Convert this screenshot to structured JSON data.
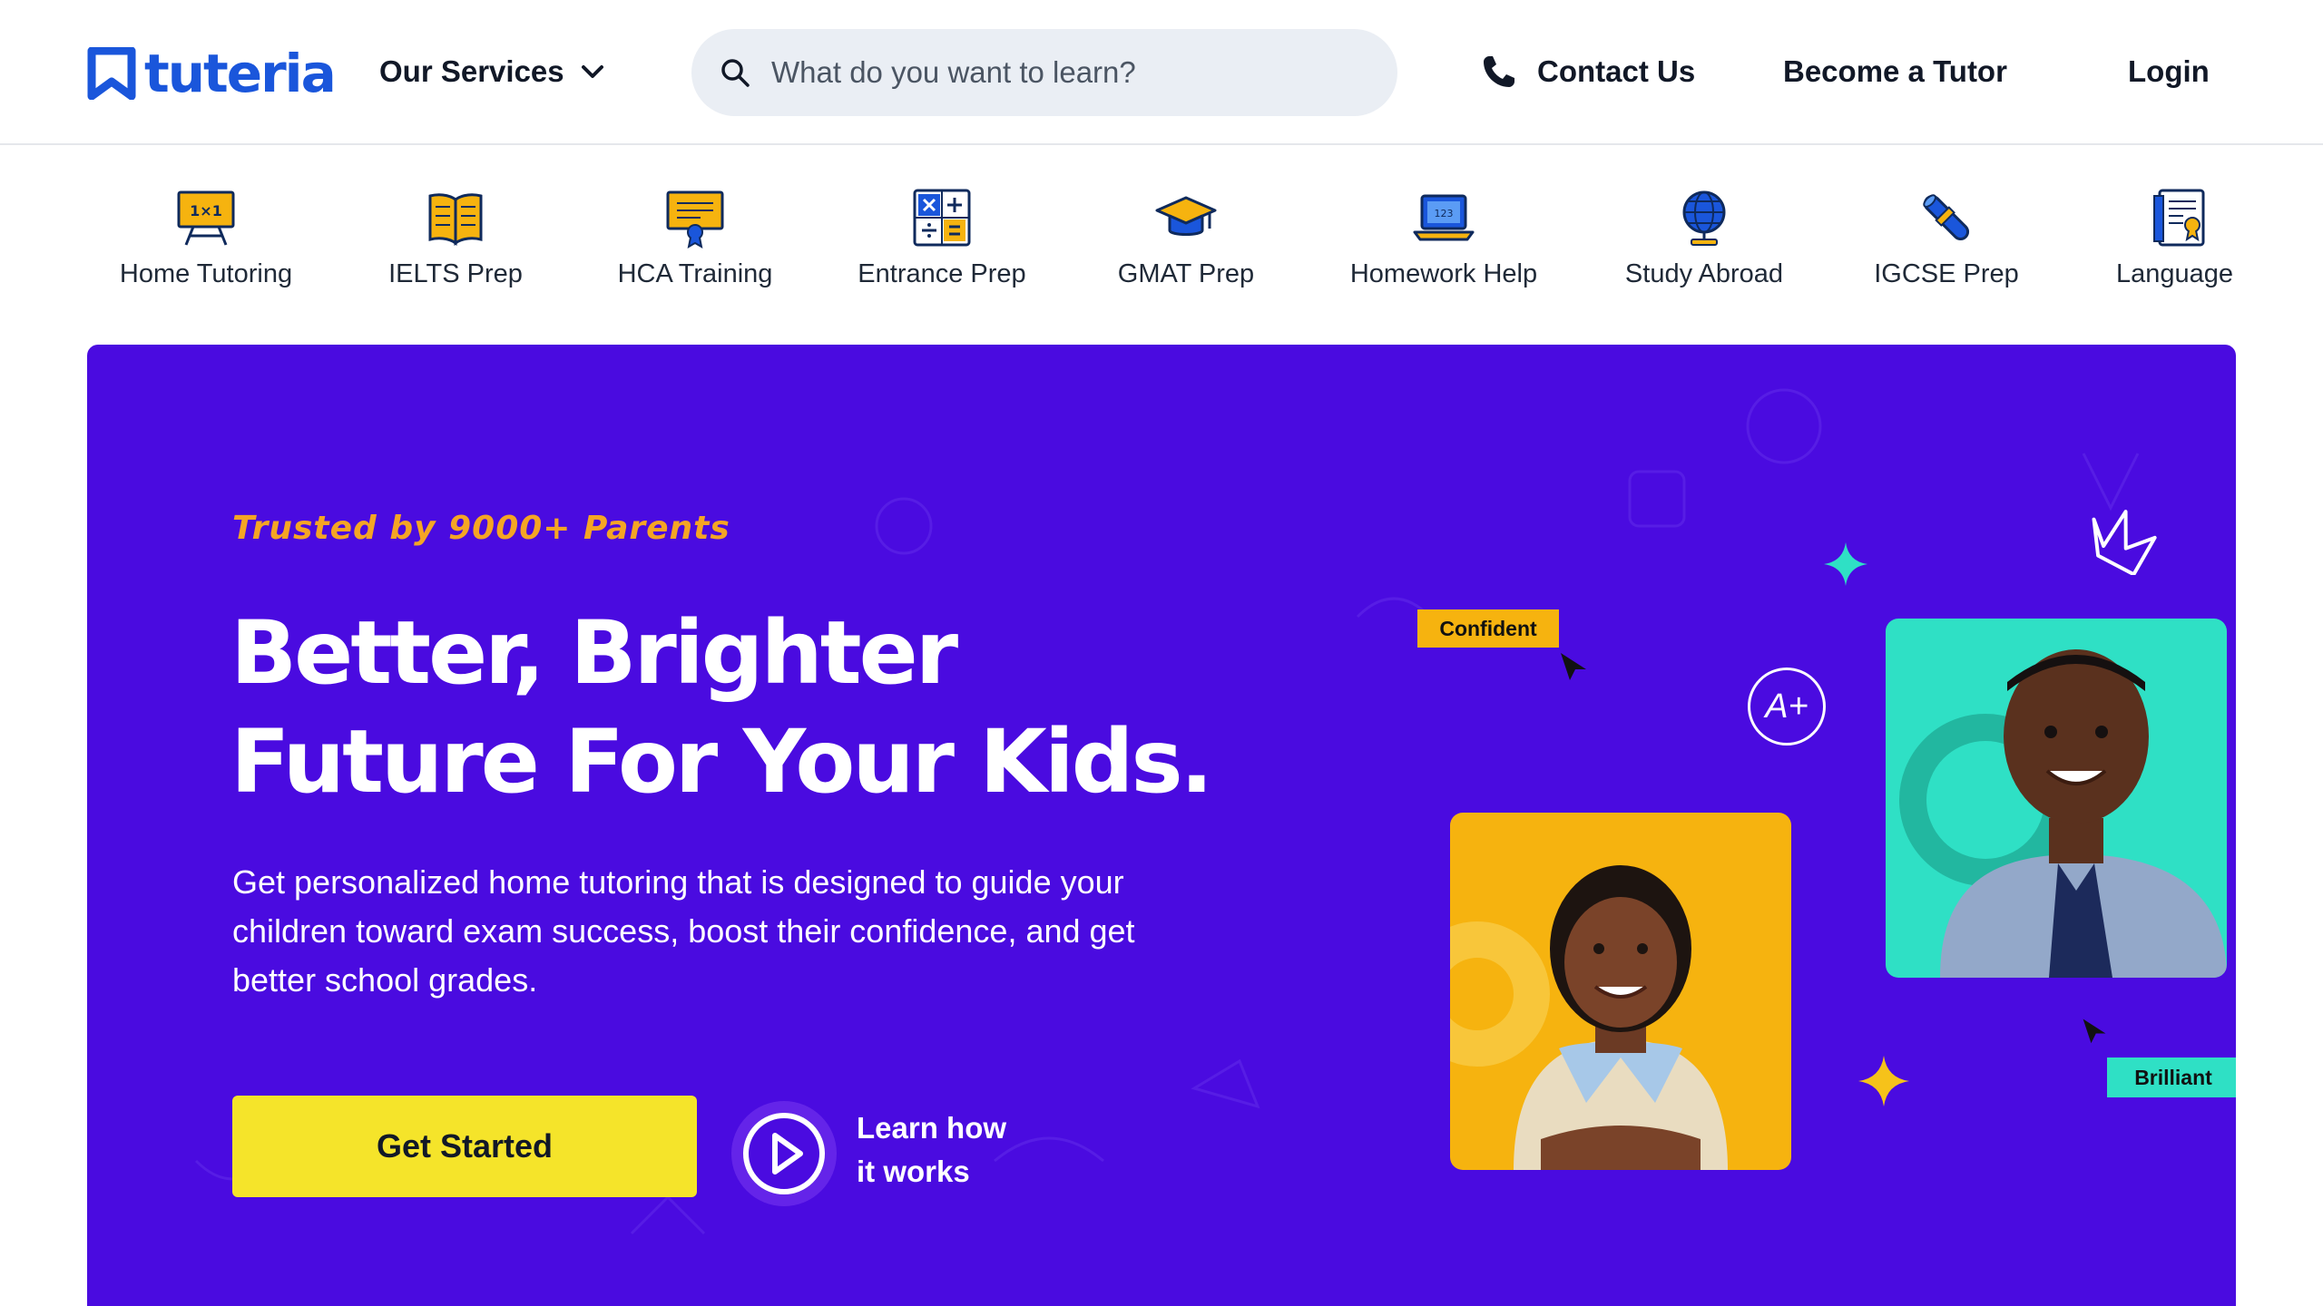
{
  "header": {
    "logo_text": "tuteria",
    "services_label": "Our Services",
    "search_placeholder": "What do you want to learn?",
    "contact_label": "Contact Us",
    "become_tutor_label": "Become a Tutor",
    "login_label": "Login"
  },
  "categories": [
    {
      "label": "Home Tutoring",
      "icon": "whiteboard-icon"
    },
    {
      "label": "IELTS Prep",
      "icon": "open-book-icon"
    },
    {
      "label": "HCA Training",
      "icon": "certificate-icon"
    },
    {
      "label": "Entrance Prep",
      "icon": "calculator-icon"
    },
    {
      "label": "GMAT Prep",
      "icon": "graduation-cap-icon"
    },
    {
      "label": "Homework Help",
      "icon": "laptop-icon"
    },
    {
      "label": "Study Abroad",
      "icon": "globe-icon"
    },
    {
      "label": "IGCSE Prep",
      "icon": "diploma-scroll-icon"
    },
    {
      "label": "Language",
      "icon": "document-badge-icon"
    }
  ],
  "hero": {
    "trusted": "Trusted by 9000+ Parents",
    "headline_line1": "Better, Brighter",
    "headline_line2": "Future For Your Kids.",
    "subtext": "Get personalized home tutoring that is designed to guide your children toward exam success, boost their confidence, and get better school grades.",
    "cta_label": "Get Started",
    "learn_line1": "Learn how",
    "learn_line2": "it works",
    "tag_confident": "Confident",
    "tag_brilliant": "Brilliant",
    "aplus": "A+"
  },
  "colors": {
    "brand_blue": "#1a56db",
    "hero_purple": "#4a0be0",
    "accent_yellow": "#f5e42a",
    "accent_orange": "#f5a524",
    "accent_teal": "#2fe0c5"
  }
}
